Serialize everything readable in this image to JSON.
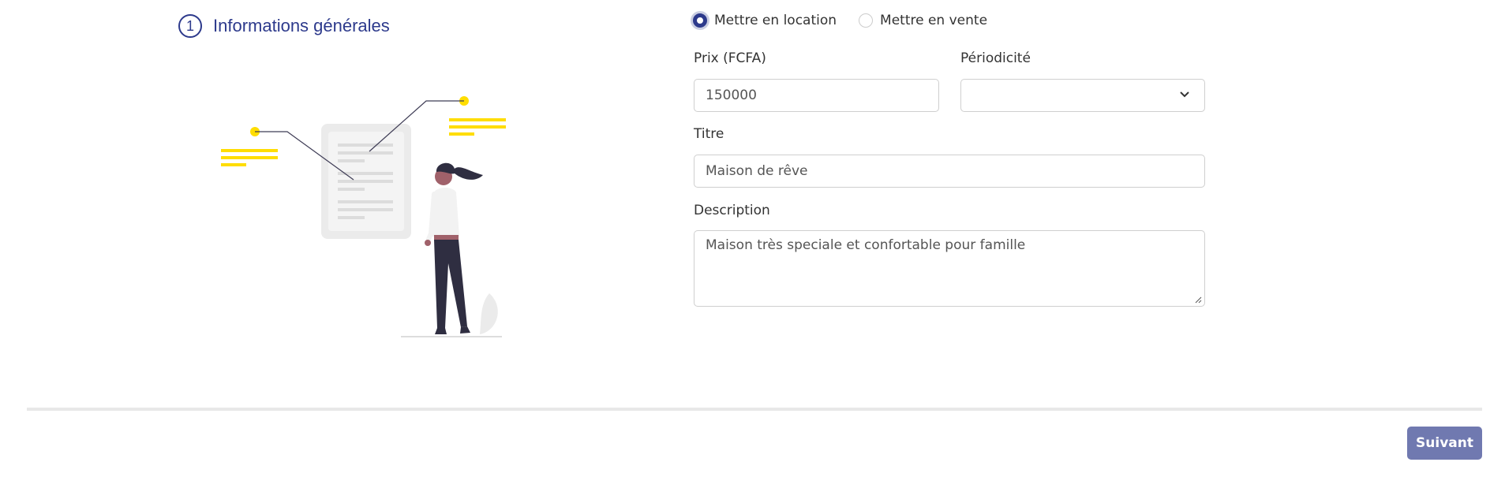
{
  "section": {
    "step_number": "1",
    "title": "Informations générales"
  },
  "listing_type": {
    "options": [
      {
        "label": "Mettre en location",
        "checked": true
      },
      {
        "label": "Mettre en vente",
        "checked": false
      }
    ]
  },
  "form": {
    "price_label": "Prix (FCFA)",
    "price_value": "150000",
    "periodicity_label": "Périodicité",
    "periodicity_value": "",
    "title_label": "Titre",
    "title_value": "Maison de rêve",
    "description_label": "Description",
    "description_value": "Maison très speciale et confortable pour famille"
  },
  "footer": {
    "next_label": "Suivant"
  },
  "colors": {
    "primary": "#2d3a8c",
    "accent_yellow": "#ffdd00",
    "button": "#7079b0"
  },
  "icons": {
    "select": "chevron-down-icon",
    "textarea": "resize-handle-icon"
  }
}
